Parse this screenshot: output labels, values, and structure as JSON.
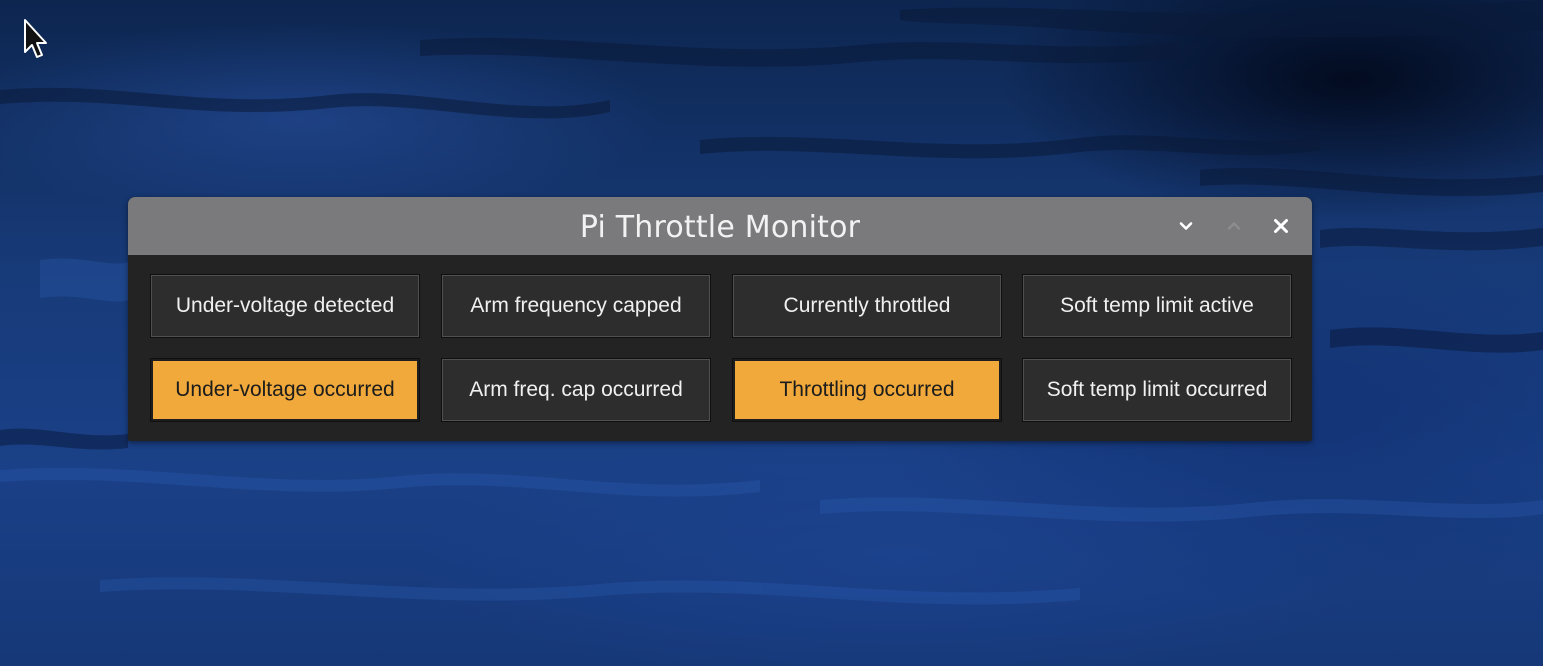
{
  "colors": {
    "desktop_bg": "#173a78",
    "titlebar_bg": "#7a7a7d",
    "window_bg": "#232323",
    "button_bg": "#2d2d2d",
    "button_active_bg": "#f0a93a"
  },
  "desktop": {
    "cursor_icon": "mouse-pointer-icon"
  },
  "window": {
    "title": "Pi Throttle Monitor",
    "controls": {
      "minimize_icon": "chevron-down-icon",
      "maximize_icon": "chevron-up-icon",
      "close_icon": "close-icon"
    },
    "status_rows": [
      [
        {
          "label": "Under-voltage detected",
          "active": false
        },
        {
          "label": "Arm frequency capped",
          "active": false
        },
        {
          "label": "Currently throttled",
          "active": false
        },
        {
          "label": "Soft temp limit active",
          "active": false
        }
      ],
      [
        {
          "label": "Under-voltage occurred",
          "active": true
        },
        {
          "label": "Arm freq. cap occurred",
          "active": false
        },
        {
          "label": "Throttling occurred",
          "active": true
        },
        {
          "label": "Soft temp limit occurred",
          "active": false
        }
      ]
    ]
  }
}
